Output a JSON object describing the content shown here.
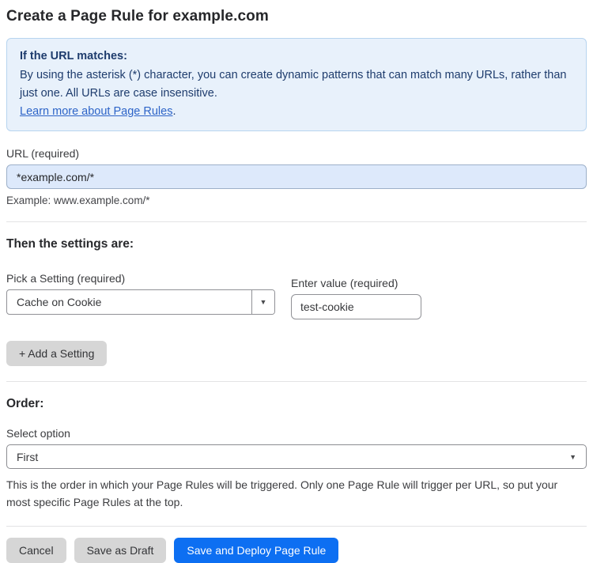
{
  "page": {
    "title": "Create a Page Rule for example.com"
  },
  "info_box": {
    "heading": "If the URL matches:",
    "body": "By using the asterisk (*) character, you can create dynamic patterns that can match many URLs, rather than just one. All URLs are case insensitive.",
    "link": "Learn more about Page Rules",
    "link_suffix": "."
  },
  "url_field": {
    "label": "URL (required)",
    "value": "*example.com/*",
    "hint": "Example: www.example.com/*"
  },
  "settings_section": {
    "heading": "Then the settings are:",
    "setting_label": "Pick a Setting (required)",
    "setting_value": "Cache on Cookie",
    "value_label": "Enter value (required)",
    "value_value": "test-cookie",
    "add_button": "+ Add a Setting"
  },
  "order_section": {
    "heading": "Order:",
    "select_label": "Select option",
    "select_value": "First",
    "help": "This is the order in which your Page Rules will be triggered. Only one Page Rule will trigger per URL, so put your most specific Page Rules at the top."
  },
  "footer": {
    "cancel": "Cancel",
    "save_draft": "Save as Draft",
    "save_deploy": "Save and Deploy Page Rule"
  },
  "icons": {
    "chevron_down": "▼"
  },
  "colors": {
    "accent_blue": "#0d6ff2",
    "info_bg": "#e8f1fb",
    "info_border": "#b7d4ef",
    "info_text": "#1e3c6d",
    "link_blue": "#2d64c8",
    "url_input_bg": "#dde9fb",
    "gray_button": "#d6d6d6"
  }
}
